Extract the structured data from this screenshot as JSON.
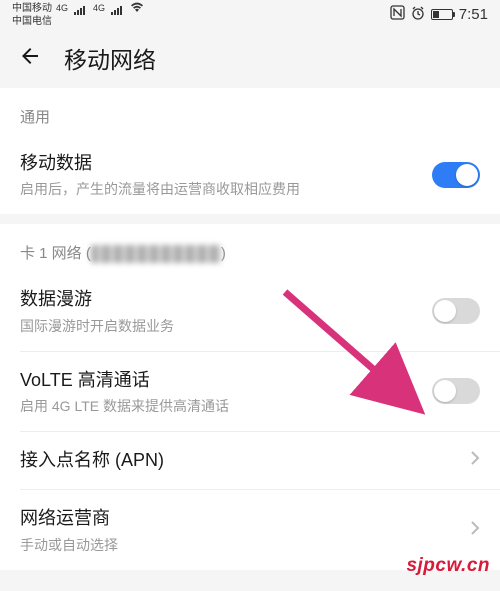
{
  "status": {
    "carrier1": "中国移动",
    "carrier2": "中国电信",
    "net_label": "4G",
    "time": "7:51"
  },
  "header": {
    "title": "移动网络"
  },
  "section_general": "通用",
  "mobile_data": {
    "title": "移动数据",
    "sub": "启用后，产生的流量将由运营商收取相应费用",
    "on": true
  },
  "sim_section_prefix": "卡 1 网络 (",
  "sim_section_suffix": ")",
  "roaming": {
    "title": "数据漫游",
    "sub": "国际漫游时开启数据业务",
    "on": false
  },
  "volte": {
    "title": "VoLTE 高清通话",
    "sub": "启用 4G LTE 数据来提供高清通话",
    "on": false
  },
  "apn": {
    "title": "接入点名称 (APN)"
  },
  "operator": {
    "title": "网络运营商",
    "sub": "手动或自动选择"
  },
  "watermark": "sjpcw.cn"
}
